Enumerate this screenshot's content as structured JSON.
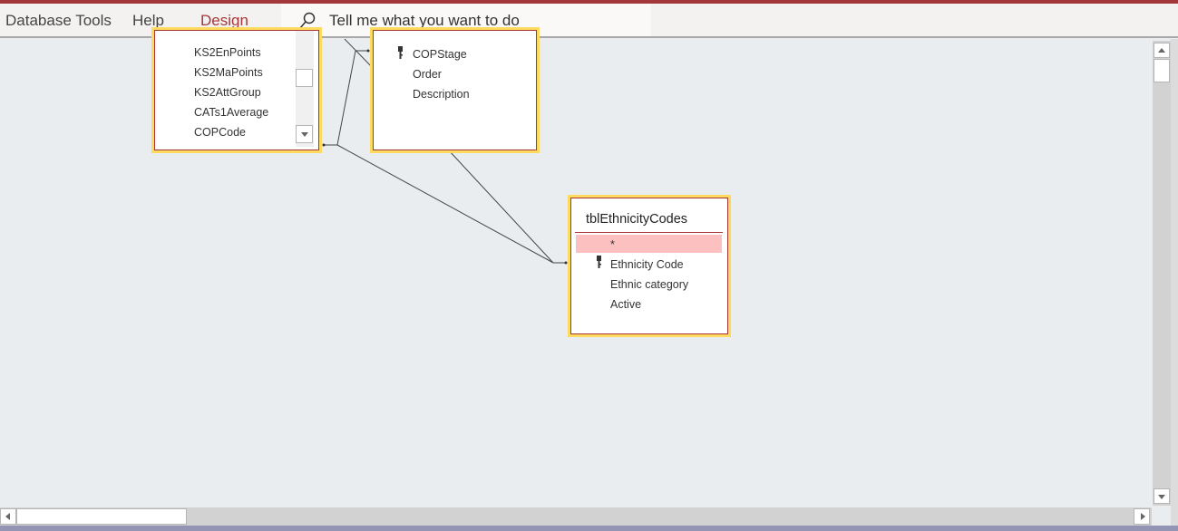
{
  "ribbon": {
    "tabs": [
      "Database Tools",
      "Help",
      "Design"
    ],
    "active_tab": "Design",
    "search_placeholder": "Tell me what you want to do"
  },
  "tables": [
    {
      "fields": [
        "KS2EnPoints",
        "KS2MaPoints",
        "KS2AttGroup",
        "CATs1Average",
        "COPCode",
        "..."
      ]
    },
    {
      "fields": [
        "COPStage",
        "Order",
        "Description"
      ],
      "key_field": "COPStage"
    },
    {
      "title": "tblEthnicityCodes",
      "fields": [
        "*",
        "Ethnicity Code",
        "Ethnic category",
        "Active"
      ],
      "key_field": "Ethnicity Code"
    }
  ],
  "colors": {
    "accent": "#a4373a",
    "table_border": "#fedb5f",
    "selected_row": "#fdc0c0"
  }
}
